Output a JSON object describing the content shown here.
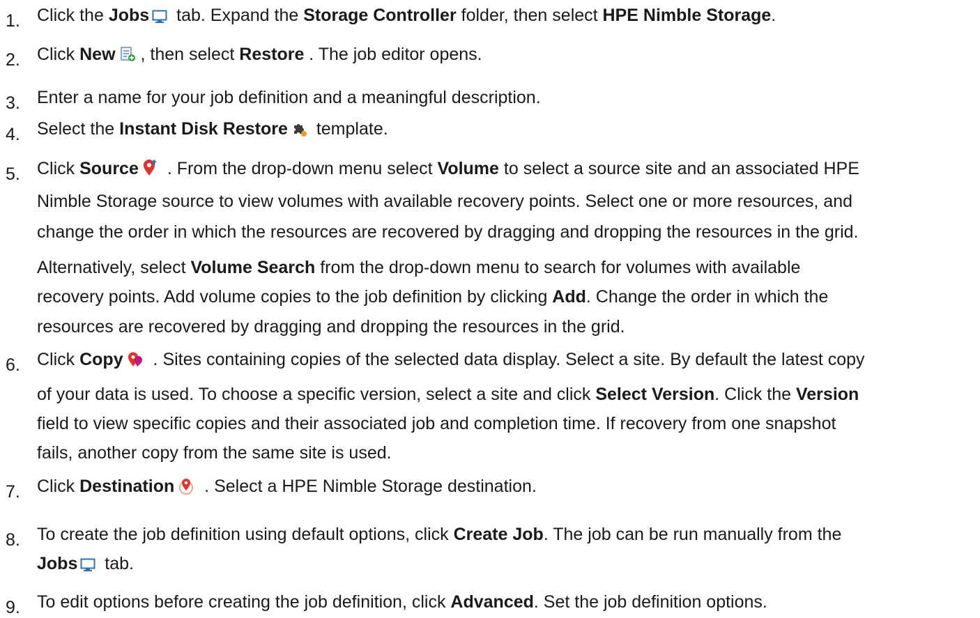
{
  "steps": [
    {
      "number": "1.",
      "lines": [
        {
          "segments": [
            {
              "text": "Click the ",
              "bold": false
            },
            {
              "text": "Jobs",
              "bold": true
            },
            {
              "icon": "monitor-icon"
            },
            {
              "text": " tab. Expand the ",
              "bold": false
            },
            {
              "text": "Storage Controller",
              "bold": true
            },
            {
              "text": " folder, then select ",
              "bold": false
            },
            {
              "text": "HPE Nimble Storage",
              "bold": true
            },
            {
              "text": ".",
              "bold": false
            }
          ]
        }
      ]
    },
    {
      "number": "2.",
      "lines": [
        {
          "segments": [
            {
              "text": "Click ",
              "bold": false
            },
            {
              "text": "New",
              "bold": true
            },
            {
              "icon": "new-job-icon"
            },
            {
              "text": ", then select ",
              "bold": false
            },
            {
              "text": "Restore",
              "bold": true
            },
            {
              "text": " . The job editor opens.",
              "bold": false
            }
          ]
        }
      ]
    },
    {
      "number": "3.",
      "lines": [
        {
          "segments": [
            {
              "text": "Enter a name for your job definition and a meaningful description.",
              "bold": false
            }
          ]
        }
      ]
    },
    {
      "number": "4.",
      "lines": [
        {
          "segments": [
            {
              "text": "Select the ",
              "bold": false
            },
            {
              "text": "Instant Disk Restore",
              "bold": true
            },
            {
              "icon": "template-puzzle-icon"
            },
            {
              "text": " template.",
              "bold": false
            }
          ]
        }
      ]
    },
    {
      "number": "5.",
      "lines": [
        {
          "segments": [
            {
              "text": "Click ",
              "bold": false
            },
            {
              "text": "Source",
              "bold": true
            },
            {
              "icon": "source-pin-icon"
            },
            {
              "text": " . From the drop-down menu select ",
              "bold": false
            },
            {
              "text": "Volume",
              "bold": true
            },
            {
              "text": " to select a source site and an associated HPE",
              "bold": false
            }
          ]
        },
        {
          "segments": [
            {
              "text": "Nimble Storage source to view volumes with available recovery points. Select one or more resources, and",
              "bold": false
            }
          ]
        },
        {
          "segments": [
            {
              "text": "change the order in which the resources are recovered by dragging and dropping the resources in the grid.",
              "bold": false
            }
          ]
        },
        {
          "segments": [
            {
              "text": "Alternatively, select ",
              "bold": false
            },
            {
              "text": "Volume Search",
              "bold": true
            },
            {
              "text": " from the drop-down menu to search for volumes with available",
              "bold": false
            }
          ]
        },
        {
          "segments": [
            {
              "text": "recovery points. Add volume copies to the job definition by clicking ",
              "bold": false
            },
            {
              "text": "Add",
              "bold": true
            },
            {
              "text": ". Change the order in which the",
              "bold": false
            }
          ]
        },
        {
          "segments": [
            {
              "text": "resources are recovered by dragging and dropping the resources in the grid.",
              "bold": false
            }
          ]
        }
      ]
    },
    {
      "number": "6.",
      "lines": [
        {
          "segments": [
            {
              "text": "Click ",
              "bold": false
            },
            {
              "text": "Copy",
              "bold": true
            },
            {
              "icon": "copy-pin-icon"
            },
            {
              "text": " . Sites containing copies of the selected data display. Select a site. By default the latest copy",
              "bold": false
            }
          ]
        },
        {
          "segments": [
            {
              "text": "of your data is used. To choose a specific version, select a site and click ",
              "bold": false
            },
            {
              "text": "Select Version",
              "bold": true
            },
            {
              "text": ". Click the ",
              "bold": false
            },
            {
              "text": "Version",
              "bold": true
            }
          ]
        },
        {
          "segments": [
            {
              "text": "field to view specific copies and their associated job and completion time. If recovery from one snapshot",
              "bold": false
            }
          ]
        },
        {
          "segments": [
            {
              "text": "fails, another copy from the same site is used.",
              "bold": false
            }
          ]
        }
      ]
    },
    {
      "number": "7.",
      "lines": [
        {
          "segments": [
            {
              "text": "Click ",
              "bold": false
            },
            {
              "text": "Destination",
              "bold": true
            },
            {
              "icon": "destination-pin-icon"
            },
            {
              "text": " . Select a HPE Nimble Storage destination.",
              "bold": false
            }
          ]
        }
      ]
    },
    {
      "number": "8.",
      "lines": [
        {
          "segments": [
            {
              "text": "To create the job definition using default options, click ",
              "bold": false
            },
            {
              "text": "Create Job",
              "bold": true
            },
            {
              "text": ". The job can be run manually from the",
              "bold": false
            }
          ]
        },
        {
          "segments": [
            {
              "text": "Jobs",
              "bold": true
            },
            {
              "icon": "monitor-icon"
            },
            {
              "text": " tab.",
              "bold": false
            }
          ]
        }
      ]
    },
    {
      "number": "9.",
      "lines": [
        {
          "segments": [
            {
              "text": "To edit options before creating the job definition, click ",
              "bold": false
            },
            {
              "text": "Advanced",
              "bold": true
            },
            {
              "text": ". Set the job definition options.",
              "bold": false
            }
          ]
        }
      ]
    }
  ]
}
